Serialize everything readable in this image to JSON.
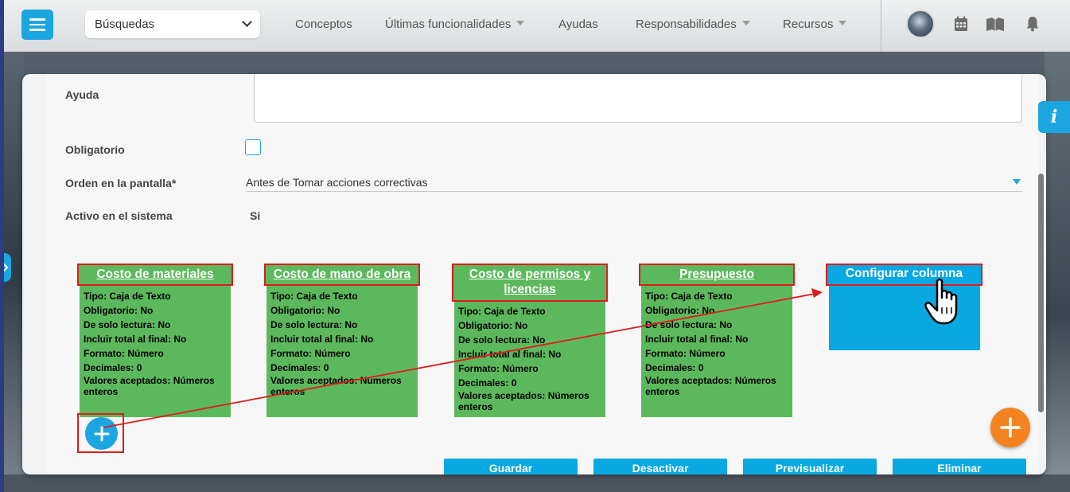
{
  "topbar": {
    "search_label": "Búsquedas",
    "nav": [
      {
        "label": "Conceptos",
        "has_caret": false
      },
      {
        "label": "Últimas funcionalidades",
        "has_caret": true
      },
      {
        "label": "Ayudas",
        "has_caret": false
      },
      {
        "label": "Responsabilidades",
        "has_caret": true
      },
      {
        "label": "Recursos",
        "has_caret": true
      }
    ],
    "icons": [
      "menu-icon",
      "calendar-icon",
      "book-icon",
      "bell-icon"
    ]
  },
  "form": {
    "help_label": "Ayuda",
    "required_label": "Obligatorio",
    "required_checked": false,
    "order_label": "Orden en la pantalla*",
    "order_value": "Antes de Tomar acciones correctivas",
    "active_label": "Activo en el sistema",
    "active_value": "Si"
  },
  "columns": [
    {
      "title": "Costo de materiales",
      "details": [
        "Tipo: Caja de Texto",
        "Obligatorio: No",
        "De solo lectura: No",
        "Incluir total al final: No",
        "Formato: Número",
        "Decimales: 0",
        "Valores aceptados: Números enteros"
      ]
    },
    {
      "title": "Costo de mano de obra",
      "details": [
        "Tipo: Caja de Texto",
        "Obligatorio: No",
        "De solo lectura: No",
        "Incluir total al final: No",
        "Formato: Número",
        "Decimales: 0",
        "Valores aceptados: Números enteros"
      ]
    },
    {
      "title": "Costo de permisos y licencias",
      "details": [
        "Tipo: Caja de Texto",
        "Obligatorio: No",
        "De solo lectura: No",
        "Incluir total al final: No",
        "Formato: Número",
        "Decimales: 0",
        "Valores aceptados: Números enteros"
      ]
    },
    {
      "title": "Presupuesto",
      "details": [
        "Tipo: Caja de Texto",
        "Obligatorio: No",
        "De solo lectura: No",
        "Incluir total al final: No",
        "Formato: Número",
        "Decimales: 0",
        "Valores aceptados: Números enteros"
      ]
    }
  ],
  "config_column": {
    "title": "Configurar columna"
  },
  "actions": {
    "save": "Guardar",
    "deactivate": "Desactivar",
    "preview": "Previsualizar",
    "delete": "Eliminar"
  },
  "info_tab": "i",
  "colors": {
    "accent": "#1ba6e0",
    "column_green": "#5cb85c",
    "config_blue": "#08a8e2",
    "highlight_red": "#e01b1b",
    "fab_orange": "#f58220"
  }
}
